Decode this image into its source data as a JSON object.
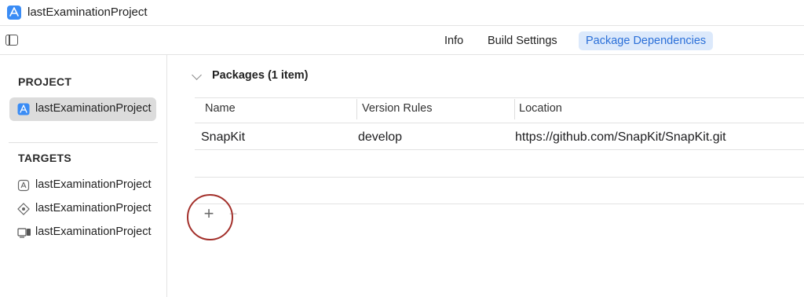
{
  "window": {
    "title": "lastExaminationProject"
  },
  "toolbar": {
    "tabs": [
      {
        "label": "Info",
        "active": false
      },
      {
        "label": "Build Settings",
        "active": false
      },
      {
        "label": "Package Dependencies",
        "active": true
      }
    ]
  },
  "sidebar": {
    "project_header": "PROJECT",
    "project_item": "lastExaminationProject",
    "targets_header": "TARGETS",
    "targets": [
      {
        "label": "lastExaminationProject",
        "icon": "app-target-icon"
      },
      {
        "label": "lastExaminationProject",
        "icon": "test-target-icon"
      },
      {
        "label": "lastExaminationProject",
        "icon": "ui-test-target-icon"
      }
    ]
  },
  "packages": {
    "title": "Packages (1 item)",
    "columns": [
      "Name",
      "Version Rules",
      "Location"
    ],
    "rows": [
      {
        "name": "SnapKit",
        "version_rule": "develop",
        "location": "https://github.com/SnapKit/SnapKit.git"
      }
    ],
    "add_label": "+",
    "remove_label": "−"
  },
  "colors": {
    "accent": "#2a6fd8",
    "active_tab_bg": "#dce9fb",
    "highlight_circle": "#a3302b",
    "app_icon": "#3a8cf5"
  }
}
